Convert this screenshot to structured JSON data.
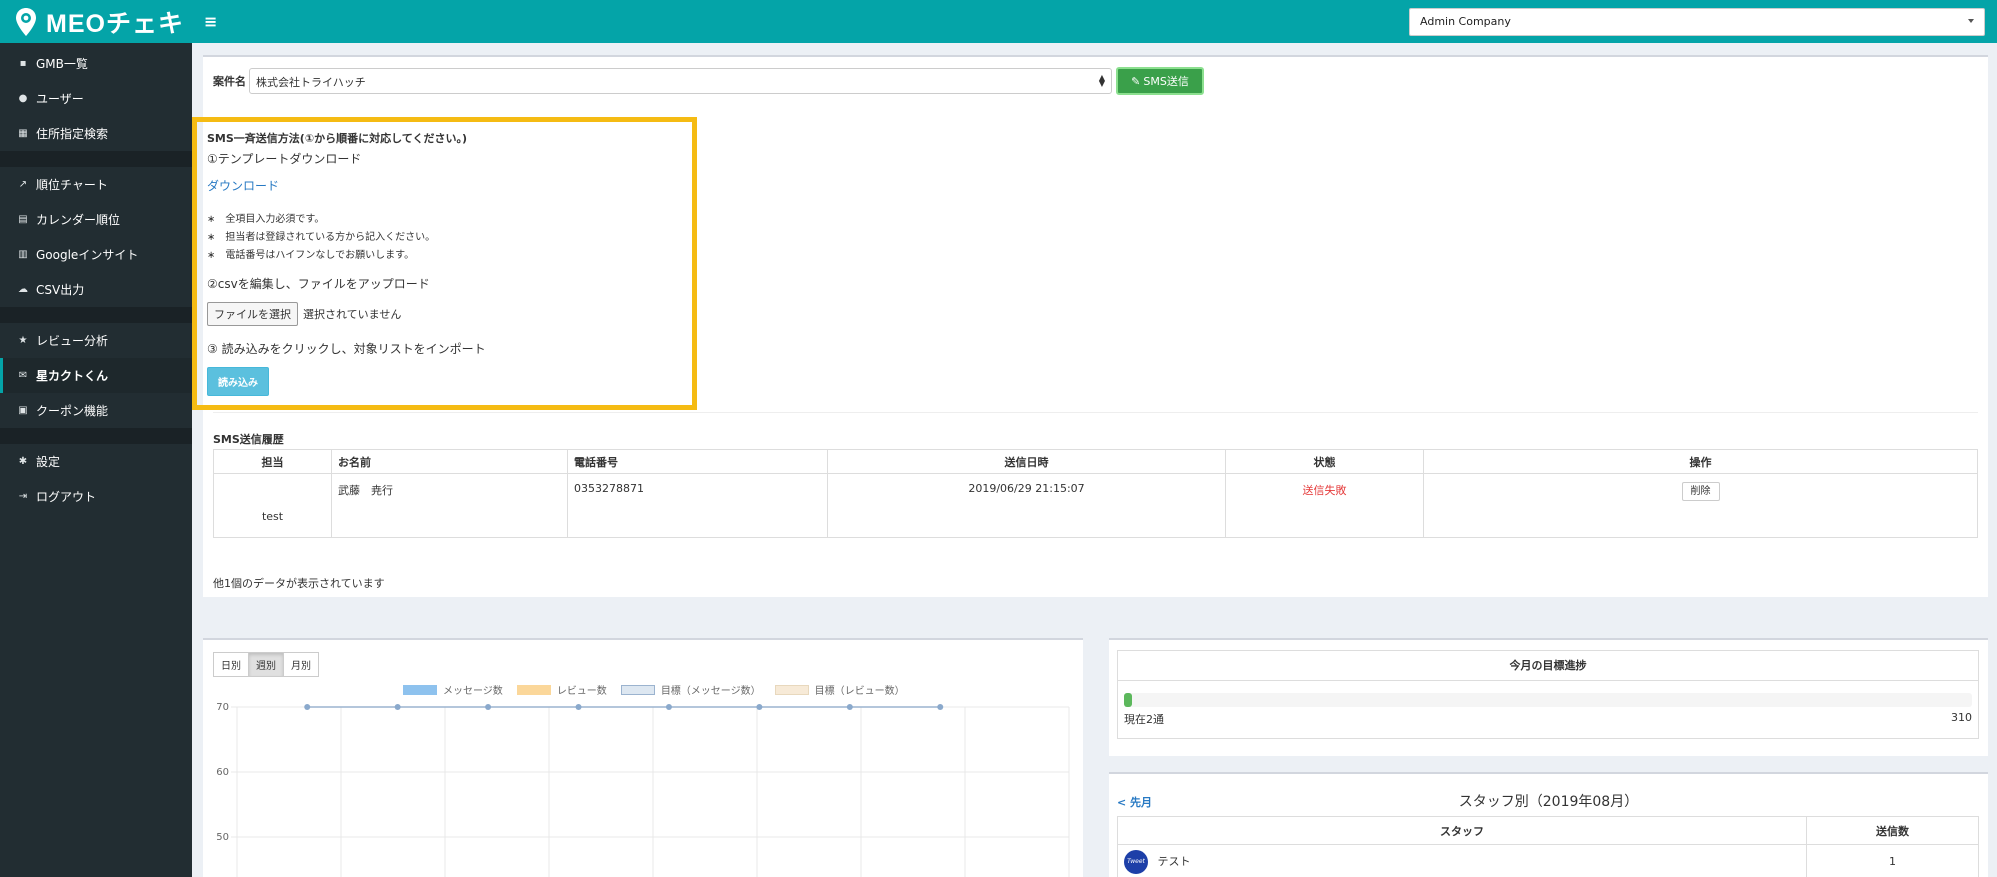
{
  "app": {
    "logo_text": "MEOチェキ",
    "hamburger": "≡"
  },
  "header": {
    "company_selected": "Admin Company"
  },
  "sidebar": {
    "groups": [
      [
        {
          "label": "GMB一覧",
          "icon": "briefcase-icon",
          "glyph": "▪"
        },
        {
          "label": "ユーザー",
          "icon": "users-icon",
          "glyph": "●"
        },
        {
          "label": "住所指定検索",
          "icon": "map-icon",
          "glyph": "▦"
        }
      ],
      [
        {
          "label": "順位チャート",
          "icon": "line-chart-icon",
          "glyph": "↗"
        },
        {
          "label": "カレンダー順位",
          "icon": "calendar-icon",
          "glyph": "▤"
        },
        {
          "label": "Googleインサイト",
          "icon": "bar-chart-icon",
          "glyph": "▥"
        },
        {
          "label": "CSV出力",
          "icon": "cloud-download-icon",
          "glyph": "☁"
        }
      ],
      [
        {
          "label": "レビュー分析",
          "icon": "star-icon",
          "glyph": "★"
        },
        {
          "label": "星カクトくん",
          "icon": "envelope-icon",
          "glyph": "✉",
          "active": true
        },
        {
          "label": "クーポン機能",
          "icon": "gift-icon",
          "glyph": "▣"
        }
      ],
      [
        {
          "label": "設定",
          "icon": "gear-icon",
          "glyph": "✱"
        },
        {
          "label": "ログアウト",
          "icon": "sign-out-icon",
          "glyph": "⇥"
        }
      ]
    ]
  },
  "main": {
    "case_label": "案件名",
    "case_value": "株式会社トライハッチ",
    "sms_button": "SMS送信",
    "howto": {
      "title": "SMS一斉送信方法(①から順番に対応してください。)",
      "step1": "①テンプレートダウンロード",
      "download": "ダウンロード",
      "notes": [
        "全項目入力必須です。",
        "担当者は登録されている方から記入ください。",
        "電話番号はハイフンなしでお願いします。"
      ],
      "step2": "②csvを編集し、ファイルをアップロード",
      "file_button": "ファイルを選択",
      "file_status": "選択されていません",
      "step3": "③ 読み込みをクリックし、対象リストをインポート",
      "read_button": "読み込み"
    },
    "history": {
      "title": "SMS送信履歴",
      "headers": [
        "担当",
        "お名前",
        "電話番号",
        "送信日時",
        "状態",
        "操作"
      ],
      "rows": [
        {
          "staff": "test",
          "name": "武藤　尭行",
          "phone": "0353278871",
          "sent_at": "2019/06/29 21:15:07",
          "status": "送信失敗",
          "action": "削除"
        }
      ],
      "count_text": "他1個のデータが表示されています"
    }
  },
  "chart_panel": {
    "tabs": [
      "日別",
      "週別",
      "月別"
    ],
    "active_tab": "週別"
  },
  "chart_data": {
    "type": "line",
    "legend": [
      "メッセージ数",
      "レビュー数",
      "目標（メッセージ数）",
      "目標（レビュー数）"
    ],
    "legend_colors": [
      "#8ec2ee",
      "#fbd79a",
      "#dde7f1",
      "#f7ead7"
    ],
    "series": [
      {
        "name": "目標（メッセージ数）",
        "values": [
          70,
          70,
          70,
          70,
          70,
          70,
          70,
          70
        ]
      }
    ],
    "ytick_labels": [
      "70",
      "60",
      "50"
    ],
    "ylim": [
      50,
      70
    ],
    "grid": true
  },
  "progress": {
    "title": "今月の目標進捗",
    "current_label": "現在2通",
    "max_label": "310",
    "fraction": 0.0065
  },
  "staff": {
    "prev_link": "< 先月",
    "title": "スタッフ別（2019年08月）",
    "headers": [
      "スタッフ",
      "送信数"
    ],
    "rows": [
      {
        "name": "テスト",
        "avatar": "Tweet",
        "count": "1"
      }
    ]
  }
}
